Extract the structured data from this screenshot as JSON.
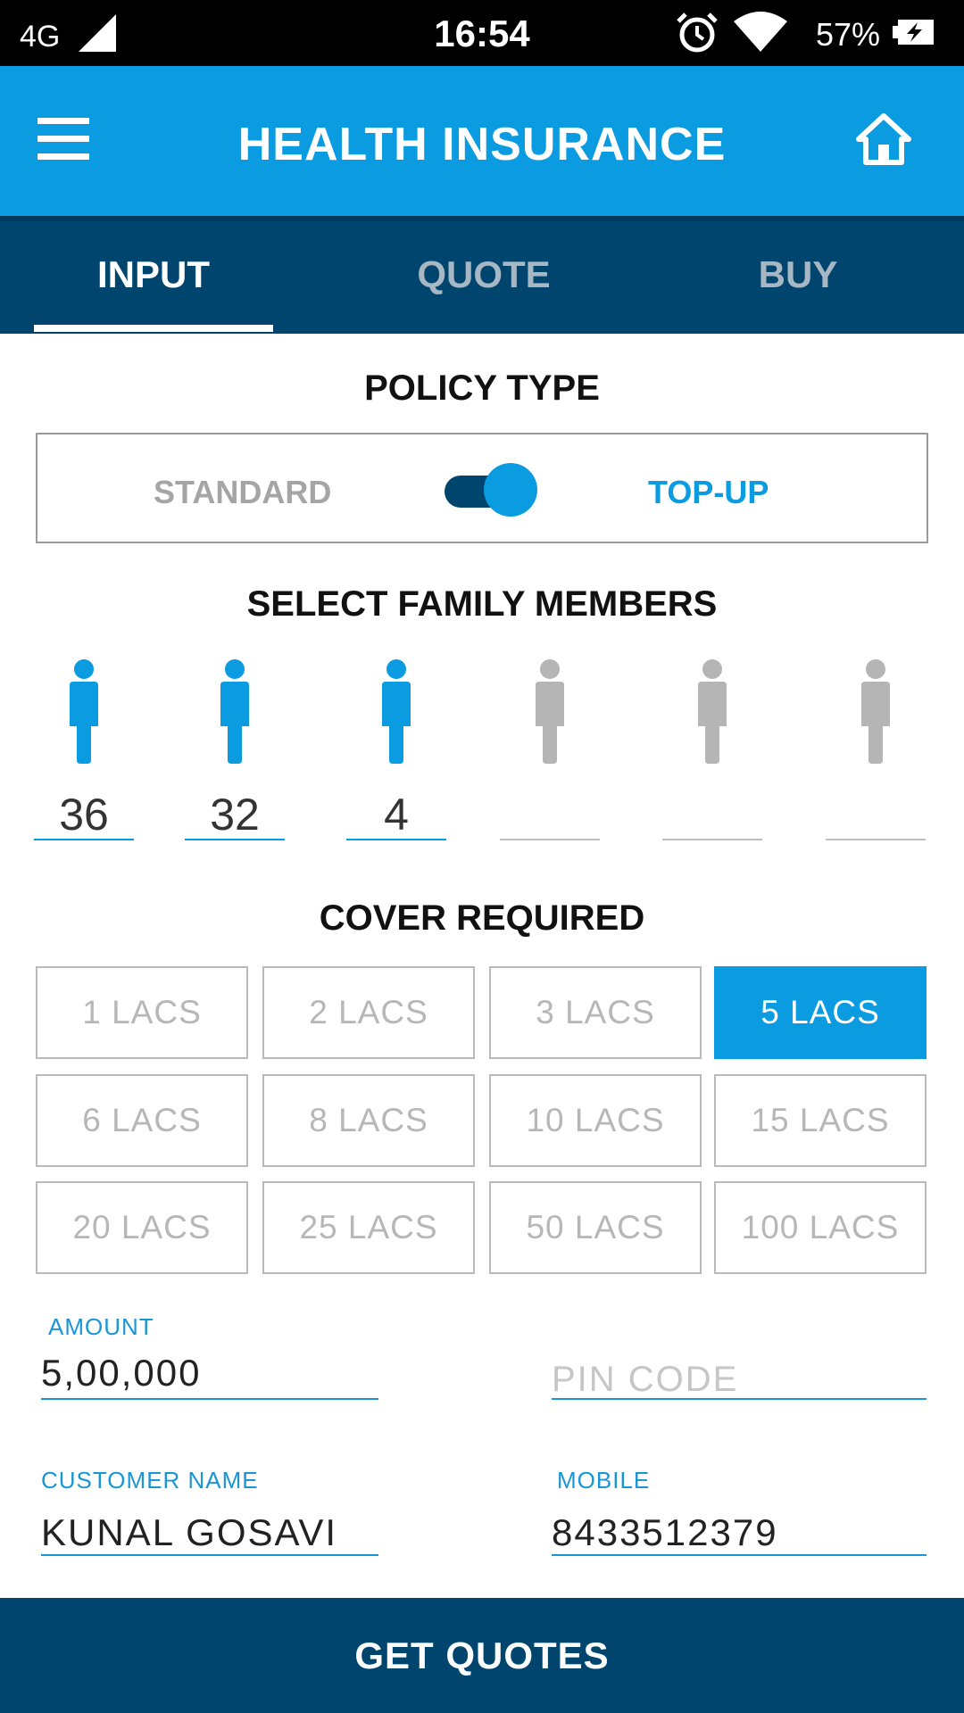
{
  "statusbar": {
    "network": "4G",
    "time": "16:54",
    "battery": "57%",
    "icons": [
      "signal-icon",
      "alarm-icon",
      "wifi-icon",
      "battery-charging-icon"
    ]
  },
  "appbar": {
    "title": "HEALTH INSURANCE",
    "menu_icon": "hamburger-menu-icon",
    "home_icon": "home-icon"
  },
  "tabs": [
    {
      "label": "INPUT",
      "active": true
    },
    {
      "label": "QUOTE",
      "active": false
    },
    {
      "label": "BUY",
      "active": false
    }
  ],
  "policy": {
    "heading": "POLICY TYPE",
    "left_label": "STANDARD",
    "right_label": "TOP-UP",
    "selected": "TOP-UP"
  },
  "family": {
    "heading": "SELECT FAMILY MEMBERS",
    "members": [
      {
        "age": "36",
        "active": true
      },
      {
        "age": "32",
        "active": true
      },
      {
        "age": "4",
        "active": true
      },
      {
        "age": "",
        "active": false
      },
      {
        "age": "",
        "active": false
      },
      {
        "age": "",
        "active": false
      }
    ]
  },
  "cover": {
    "heading": "COVER REQUIRED",
    "options": [
      "1 LACS",
      "2 LACS",
      "3 LACS",
      "5 LACS",
      "6 LACS",
      "8 LACS",
      "10 LACS",
      "15 LACS",
      "20 LACS",
      "25 LACS",
      "50 LACS",
      "100 LACS"
    ],
    "selected": "5 LACS"
  },
  "form": {
    "amount_label": "AMOUNT",
    "amount_value": "5,00,000",
    "pin_placeholder": "PIN CODE",
    "name_label": "CUSTOMER NAME",
    "name_value": "KUNAL GOSAVI",
    "mobile_label": "MOBILE",
    "mobile_value": "8433512379"
  },
  "cta": {
    "label": "GET QUOTES"
  },
  "colors": {
    "primary": "#0a9be0",
    "dark": "#00456d",
    "inactive": "#b5b5b5"
  }
}
